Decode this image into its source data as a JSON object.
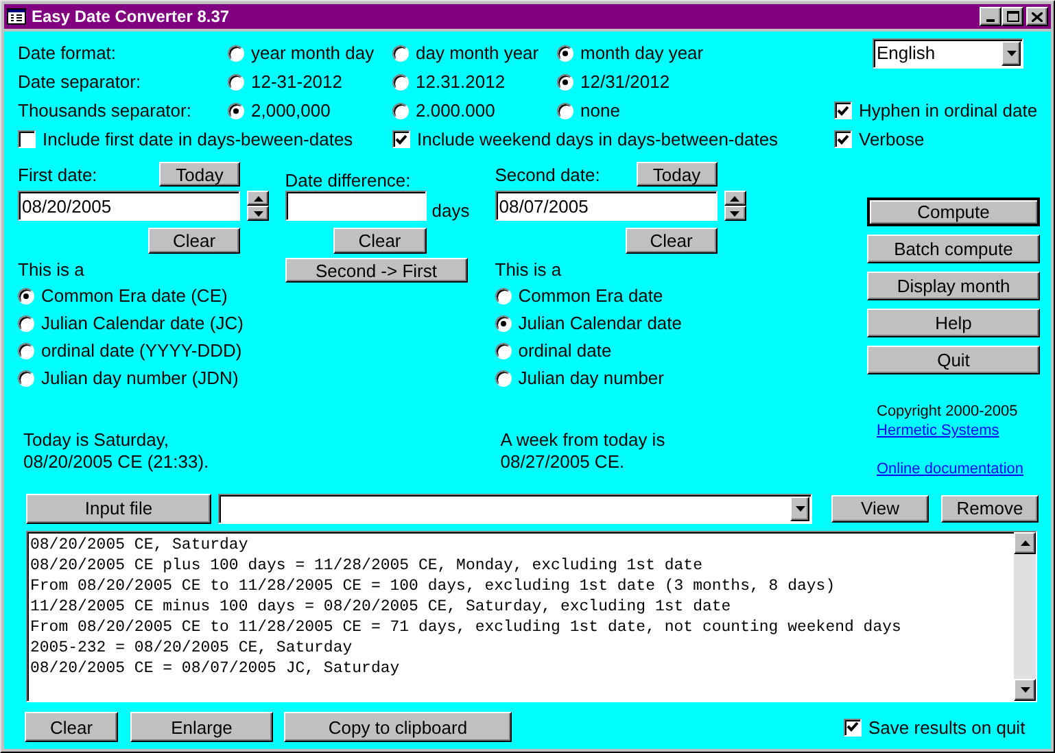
{
  "window": {
    "title": "Easy Date Converter 8.37"
  },
  "options": [
    {
      "label": "Date format:",
      "choices": [
        {
          "label": "year month day",
          "selected": false
        },
        {
          "label": "day month year",
          "selected": false
        },
        {
          "label": "month day year",
          "selected": true
        }
      ]
    },
    {
      "label": "Date separator:",
      "choices": [
        {
          "label": "12-31-2012",
          "selected": false
        },
        {
          "label": "12.31.2012",
          "selected": false
        },
        {
          "label": "12/31/2012",
          "selected": true
        }
      ]
    },
    {
      "label": "Thousands separator:",
      "choices": [
        {
          "label": "2,000,000",
          "selected": true
        },
        {
          "label": "2.000.000",
          "selected": false
        },
        {
          "label": "none",
          "selected": false
        }
      ]
    }
  ],
  "language": {
    "value": "English"
  },
  "checkboxes": [
    {
      "label": "Include first date in days-beween-dates",
      "checked": false
    },
    {
      "label": "Include weekend days in days-between-dates",
      "checked": true
    },
    {
      "label": "Hyphen in ordinal date",
      "checked": true
    },
    {
      "label": "Verbose",
      "checked": true
    }
  ],
  "first_date": {
    "label": "First date:",
    "today_button": "Today",
    "value": "08/20/2005",
    "clear_button": "Clear",
    "type_label": "This is a",
    "types": [
      {
        "label": "Common Era date (CE)",
        "selected": true
      },
      {
        "label": "Julian Calendar date (JC)",
        "selected": false
      },
      {
        "label": "ordinal date (YYYY-DDD)",
        "selected": false
      },
      {
        "label": "Julian day number (JDN)",
        "selected": false
      }
    ],
    "note": [
      "Today is Saturday,",
      "08/20/2005 CE (21:33)."
    ]
  },
  "date_difference": {
    "label": "Date difference:",
    "unit": "days",
    "clear_button": "Clear",
    "swap_button": "Second -> First"
  },
  "second_date": {
    "label": "Second date:",
    "today_button": "Today",
    "value": "08/07/2005",
    "clear_button": "Clear",
    "type_label": "This is a",
    "types": [
      {
        "label": "Common Era date",
        "selected": false
      },
      {
        "label": "Julian Calendar date",
        "selected": true
      },
      {
        "label": "ordinal date",
        "selected": false
      },
      {
        "label": "Julian day number",
        "selected": false
      }
    ],
    "note": [
      "A week from today is",
      "08/27/2005 CE."
    ]
  },
  "actions": [
    {
      "label": "Compute",
      "focused": true
    },
    {
      "label": "Batch compute",
      "focused": false
    },
    {
      "label": "Display month",
      "focused": false
    },
    {
      "label": "Help",
      "focused": false
    },
    {
      "label": "Quit",
      "focused": false
    }
  ],
  "copyright": "Copyright 2000-2005",
  "links": [
    "Hermetic Systems",
    "Online documentation"
  ],
  "input_file_button": "Input file",
  "file_buttons": [
    "View",
    "Remove"
  ],
  "results": [
    "08/20/2005 CE, Saturday",
    "08/20/2005 CE plus 100 days = 11/28/2005 CE, Monday, excluding 1st date",
    "From 08/20/2005 CE to 11/28/2005 CE = 100 days, excluding 1st date (3 months, 8 days)",
    "11/28/2005 CE minus 100 days = 08/20/2005 CE, Saturday, excluding 1st date",
    "From 08/20/2005 CE to 11/28/2005 CE = 71 days, excluding 1st date, not counting weekend days",
    "2005-232 = 08/20/2005 CE, Saturday",
    "08/20/2005 CE = 08/07/2005 JC, Saturday"
  ],
  "bottom_buttons": [
    "Clear",
    "Enlarge",
    "Copy to clipboard"
  ],
  "save_results": {
    "label": "Save results on quit",
    "checked": true
  }
}
